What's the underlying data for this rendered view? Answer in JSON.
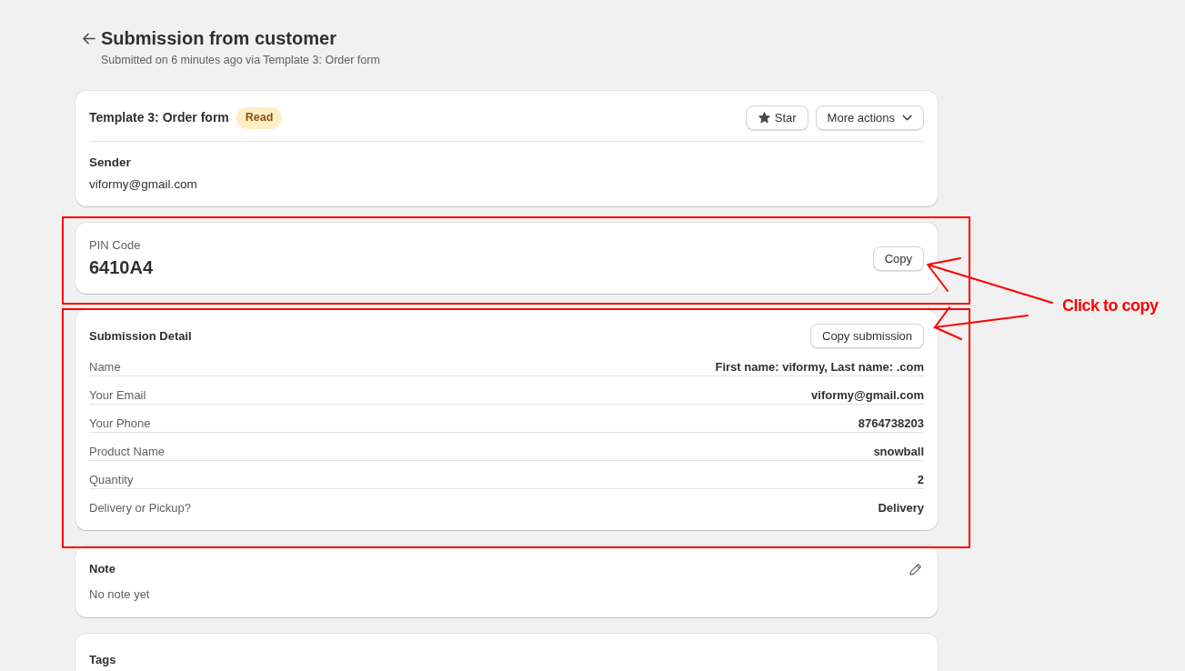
{
  "header": {
    "title": "Submission from customer",
    "subtitle": "Submitted on 6 minutes ago via Template 3: Order form"
  },
  "summary_card": {
    "title": "Template 3: Order form",
    "badge": "Read",
    "buttons": [
      {
        "label": "Star",
        "kind": "star"
      },
      {
        "label": "More actions",
        "kind": "menu"
      }
    ],
    "sender_label": "Sender",
    "sender_email": "viformy@gmail.com"
  },
  "pin_card": {
    "label": "PIN Code",
    "value": "6410A4",
    "button": "Copy"
  },
  "detail_card": {
    "title": "Submission Detail",
    "button": "Copy submission",
    "rows": [
      {
        "label": "Name",
        "value": "First name: viformy, Last name: .com"
      },
      {
        "label": "Your Email",
        "value": "viformy@gmail.com"
      },
      {
        "label": "Your Phone",
        "value": "8764738203"
      },
      {
        "label": "Product Name",
        "value": "snowball"
      },
      {
        "label": "Quantity",
        "value": "2"
      },
      {
        "label": "Delivery or Pickup?",
        "value": "Delivery"
      }
    ]
  },
  "note_card": {
    "title": "Note",
    "text": "No note yet"
  },
  "tags_card": {
    "title": "Tags"
  },
  "annotation": {
    "text": "Click to copy"
  }
}
